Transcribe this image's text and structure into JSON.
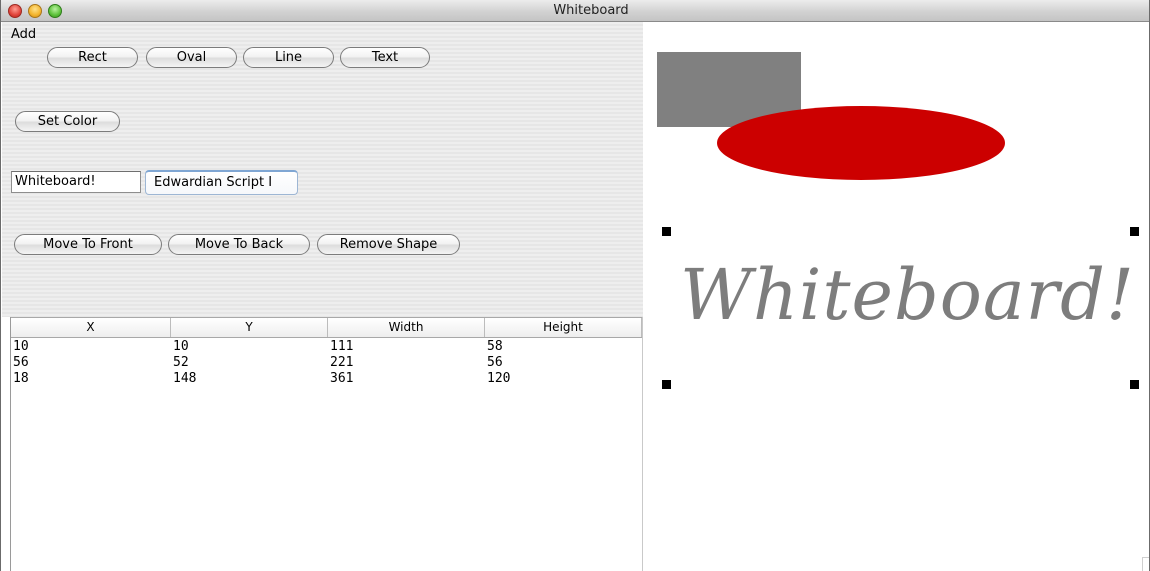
{
  "window": {
    "title": "Whiteboard"
  },
  "controls": {
    "add_label": "Add",
    "add_buttons": [
      "Rect",
      "Oval",
      "Line",
      "Text"
    ],
    "set_color_label": "Set Color",
    "text_value": "Whiteboard!",
    "font_value": "Edwardian Script I",
    "move_to_front_label": "Move To Front",
    "move_to_back_label": "Move To Back",
    "remove_shape_label": "Remove Shape"
  },
  "table": {
    "columns": [
      "X",
      "Y",
      "Width",
      "Height"
    ],
    "rows": [
      [
        "10",
        "10",
        "111",
        "58"
      ],
      [
        "56",
        "52",
        "221",
        "56"
      ],
      [
        "18",
        "148",
        "361",
        "120"
      ]
    ]
  },
  "canvas": {
    "shapes": [
      {
        "type": "rect",
        "color": "#808080"
      },
      {
        "type": "oval",
        "color": "#cc0000"
      },
      {
        "type": "text",
        "text": "Whiteboard!",
        "color": "#7d7d7d",
        "selected": true
      }
    ]
  }
}
